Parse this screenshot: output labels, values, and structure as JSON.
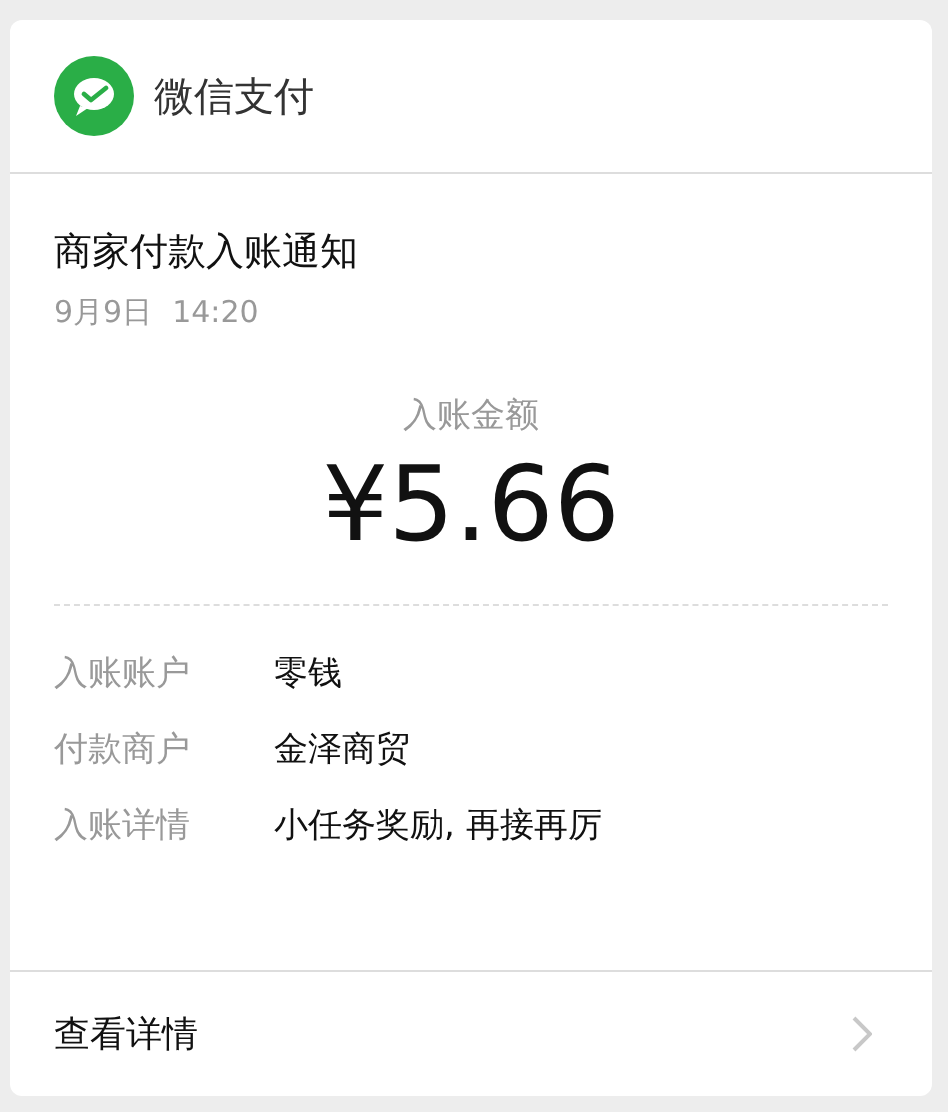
{
  "header": {
    "app_name": "微信支付"
  },
  "notice": {
    "title": "商家付款入账通知",
    "date": "9月9日",
    "time": "14:20"
  },
  "amount": {
    "label": "入账金额",
    "value": "¥5.66"
  },
  "details": [
    {
      "label": "入账账户",
      "value": "零钱"
    },
    {
      "label": "付款商户",
      "value": "金泽商贸"
    },
    {
      "label": "入账详情",
      "value": "小任务奖励, 再接再厉"
    }
  ],
  "footer": {
    "link": "查看详情"
  }
}
